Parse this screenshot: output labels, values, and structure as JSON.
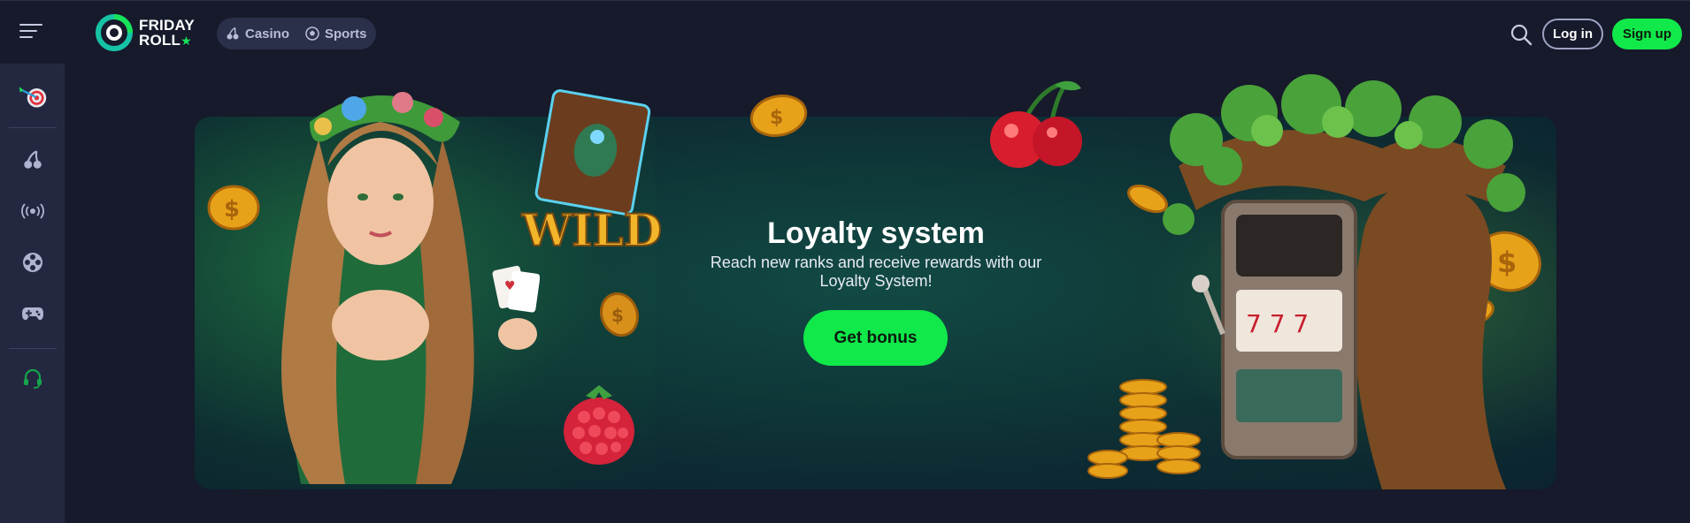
{
  "header": {
    "logo": {
      "line1": "FRIDAY",
      "line2": "ROLL"
    },
    "nav": [
      {
        "label": "Casino",
        "icon": "cherry-icon"
      },
      {
        "label": "Sports",
        "icon": "soccer-ball-icon"
      }
    ],
    "login_label": "Log in",
    "signup_label": "Sign up"
  },
  "sidebar": {
    "items": [
      {
        "icon": "target-dart-icon"
      },
      {
        "icon": "cherry-icon"
      },
      {
        "icon": "live-broadcast-icon"
      },
      {
        "icon": "film-reel-icon"
      },
      {
        "icon": "gamepad-icon"
      },
      {
        "icon": "headset-support-icon"
      }
    ]
  },
  "banner": {
    "title": "Loyalty system",
    "subtitle": "Reach new ranks and receive rewards with our Loyalty System!",
    "button_label": "Get bonus",
    "art_text": "WILD"
  },
  "colors": {
    "background": "#161a2b",
    "sidebar": "#232840",
    "accent_green": "#11e84a",
    "nav_pill": "#2b304a"
  }
}
